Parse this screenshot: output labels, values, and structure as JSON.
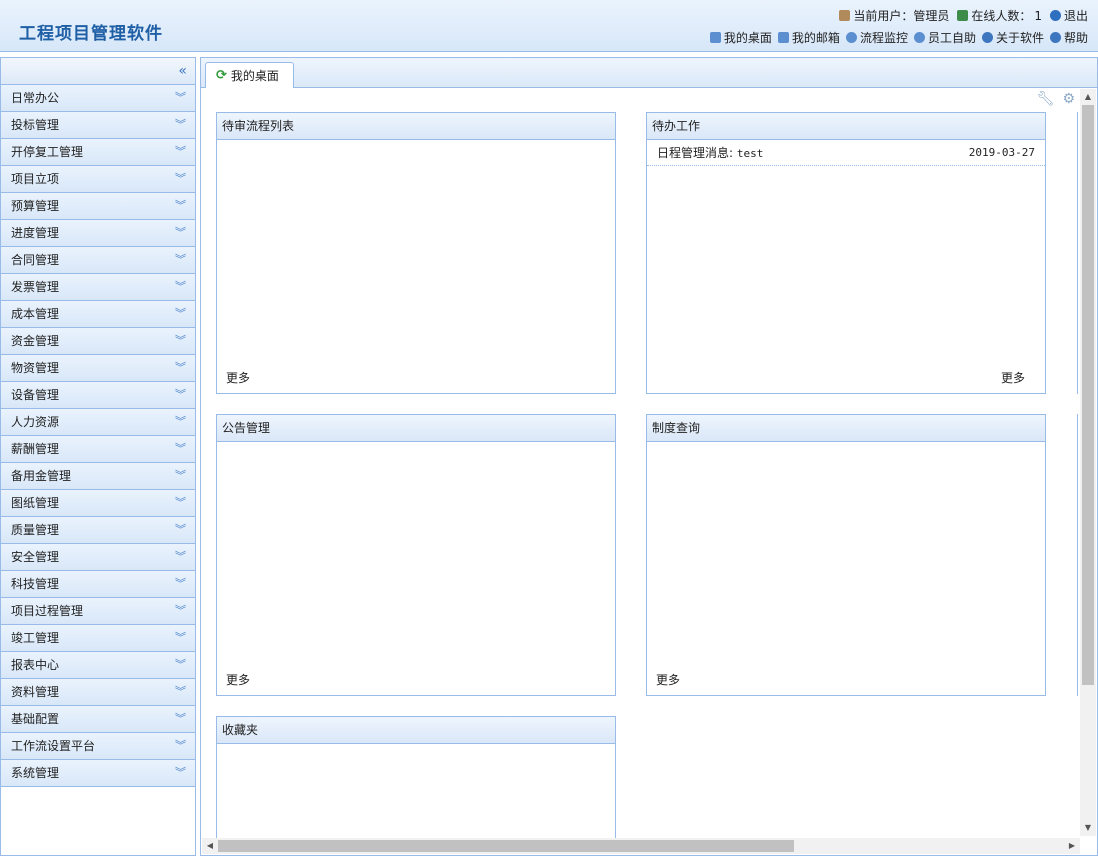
{
  "app": {
    "title": "工程项目管理软件"
  },
  "header": {
    "current_user_label": "当前用户：管理员",
    "online_label": "在线人数：",
    "online_count": "1",
    "logout": "退出",
    "nav": [
      "我的桌面",
      "我的邮箱",
      "流程监控",
      "员工自助",
      "关于软件",
      "帮助"
    ]
  },
  "sidebar": {
    "items": [
      "日常办公",
      "投标管理",
      "开停复工管理",
      "项目立项",
      "预算管理",
      "进度管理",
      "合同管理",
      "发票管理",
      "成本管理",
      "资金管理",
      "物资管理",
      "设备管理",
      "人力资源",
      "薪酬管理",
      "备用金管理",
      "图纸管理",
      "质量管理",
      "安全管理",
      "科技管理",
      "项目过程管理",
      "竣工管理",
      "报表中心",
      "资料管理",
      "基础配置",
      "工作流设置平台",
      "系统管理"
    ]
  },
  "tabs": [
    {
      "label": "我的桌面"
    }
  ],
  "portlets": {
    "pending": {
      "title": "待审流程列表",
      "more": "更多"
    },
    "todo": {
      "title": "待办工作",
      "more": "更多",
      "rows": [
        {
          "title": "日程管理消息:",
          "value": "test",
          "date": "2019-03-27"
        }
      ]
    },
    "notice": {
      "title": "公告管理",
      "more": "更多"
    },
    "policy": {
      "title": "制度查询",
      "more": "更多"
    },
    "favorites": {
      "title": "收藏夹"
    }
  },
  "colors": {
    "accent": "#1f5fa6",
    "border": "#99bbe8",
    "header_bg": "#dbe8f8"
  }
}
